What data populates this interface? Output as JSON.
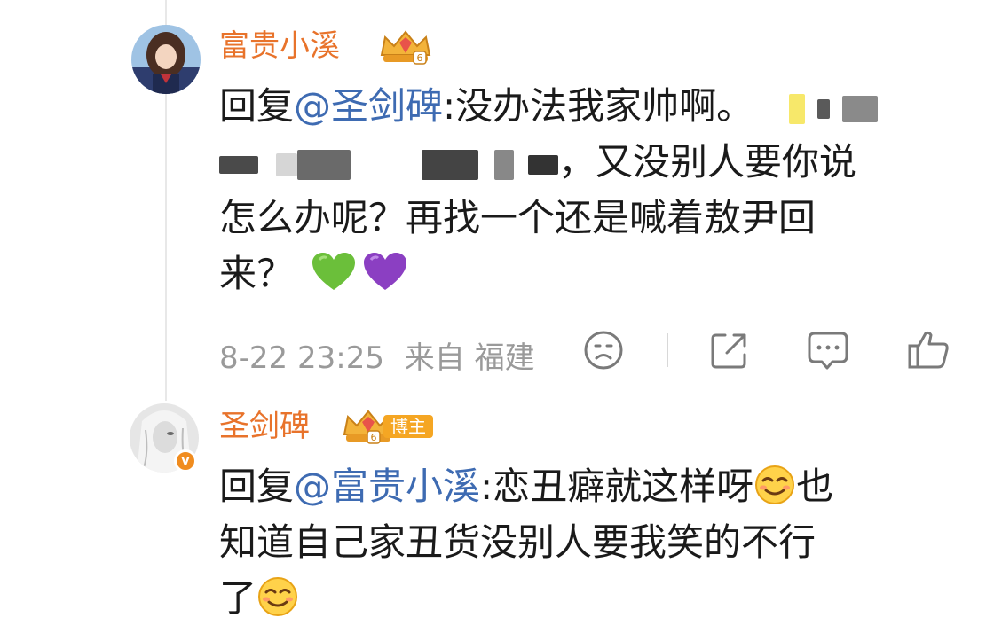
{
  "comments": [
    {
      "username": "富贵小溪",
      "text_prefix": "回复",
      "mention": "@圣剑碑",
      "text_line1": ":没办法我家帅啊。",
      "text_rest_start": "，又没别人要你说",
      "text_rest_2": "怎么办呢？再找一个还是喊着敖尹回",
      "text_rest_3": "来？",
      "emojis": [
        "green-heart",
        "purple-heart"
      ],
      "time": "8-22 23:25",
      "source": "来自 福建",
      "badge_icon": "crown-badge-icon"
    },
    {
      "username": "圣剑碑",
      "badge_label": "博主",
      "text_prefix": "回复",
      "mention": "@富贵小溪",
      "text_line1": ":恋丑癖就这样呀",
      "text_after_emoji": "也",
      "text_line2": "知道自己家丑货没别人要我笑的不行",
      "text_line3": "了",
      "verified_mark": "v",
      "badge_icon": "crown-badge-icon"
    }
  ],
  "actions": [
    {
      "name": "sad-face-icon"
    },
    {
      "name": "share-icon"
    },
    {
      "name": "comment-icon"
    },
    {
      "name": "like-icon"
    }
  ],
  "colors": {
    "username": "#e8732b",
    "mention": "#3e6bb2",
    "meta": "#9a9a9a"
  }
}
